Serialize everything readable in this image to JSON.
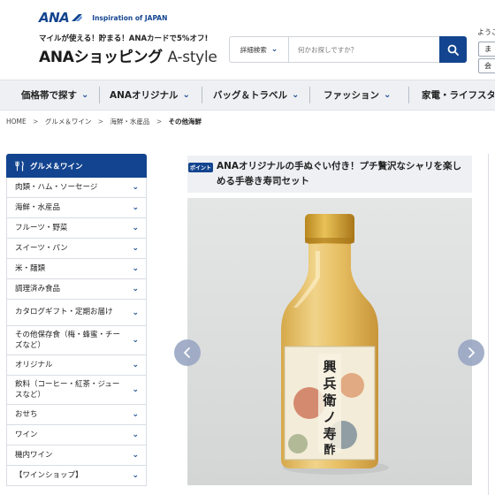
{
  "header": {
    "brand_logo": "ANA",
    "tagline": "Inspiration of JAPAN",
    "mile_promo": "マイルが使える！貯まる！ANAカードで5%オフ!",
    "site_title": "ANAショッピング",
    "site_title_style": "A-style",
    "welcome_text": "ようこ",
    "side_button_1": "ま",
    "side_button_2": "会"
  },
  "search": {
    "advanced_label": "詳細検索",
    "placeholder": "何かお探しですか？",
    "icon": "search-icon"
  },
  "nav": {
    "items": [
      {
        "label": "価格帯で探す"
      },
      {
        "label": "ANAオリジナル"
      },
      {
        "label": "バッグ＆トラベル"
      },
      {
        "label": "ファッション"
      },
      {
        "label": "家電・ライフスタイ"
      }
    ]
  },
  "breadcrumb": {
    "items": [
      "HOME",
      "グルメ＆ワイン",
      "海鮮・水産品"
    ],
    "current": "その他海鮮"
  },
  "sidebar": {
    "heading": "グルメ＆ワイン",
    "items": [
      {
        "label": "肉類・ハム・ソーセージ"
      },
      {
        "label": "海鮮・水産品"
      },
      {
        "label": "フルーツ・野菜"
      },
      {
        "label": "スイーツ・パン"
      },
      {
        "label": "米・麺類"
      },
      {
        "label": "調理済み食品"
      },
      {
        "label": "カタログギフト・定期お届け"
      },
      {
        "label": "その他保存食（梅・蜂蜜・チーズなど）"
      },
      {
        "label": "オリジナル"
      },
      {
        "label": "飲料（コーヒー・紅茶・ジュースなど）"
      },
      {
        "label": "おせち"
      },
      {
        "label": "ワイン"
      },
      {
        "label": "機内ワイン"
      },
      {
        "label": "【ワインショップ】"
      }
    ]
  },
  "product": {
    "badge": "ポイント",
    "title": "ANAオリジナルの手ぬぐい付き！プチ贅沢なシャリを楽しめる手巻き寿司セット",
    "bottle_label": "興兵衛ノ寿酢"
  },
  "colors": {
    "brand_navy": "#13448f",
    "nav_bg": "#eef0f3"
  }
}
